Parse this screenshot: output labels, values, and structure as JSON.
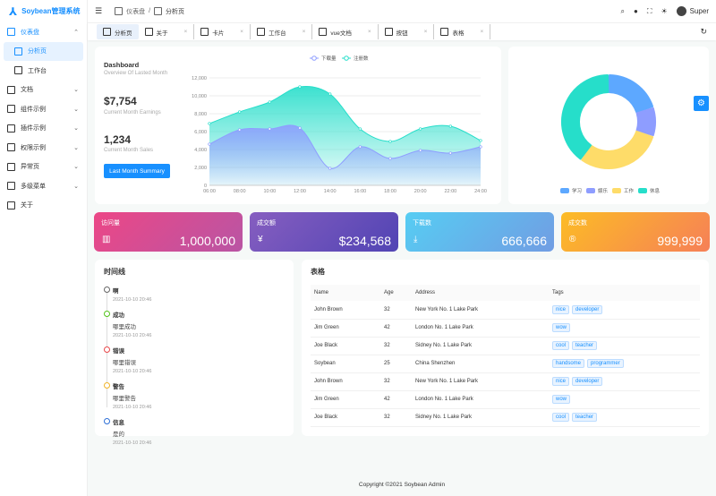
{
  "app": {
    "title": "Soybean管理系统"
  },
  "sidebar": {
    "items": [
      {
        "label": "仪表盘",
        "icon": "dashboard-icon",
        "open": true
      },
      {
        "label": "分析页",
        "icon": "analysis-icon",
        "active": true,
        "sub": true
      },
      {
        "label": "工作台",
        "icon": "monitor-icon",
        "sub": true
      },
      {
        "label": "文档",
        "icon": "document-icon"
      },
      {
        "label": "组件示例",
        "icon": "component-icon"
      },
      {
        "label": "插件示例",
        "icon": "plugin-icon"
      },
      {
        "label": "权限示例",
        "icon": "shield-icon"
      },
      {
        "label": "异常页",
        "icon": "exception-icon"
      },
      {
        "label": "多级菜单",
        "icon": "menu-icon"
      },
      {
        "label": "关于",
        "icon": "about-icon"
      }
    ]
  },
  "header": {
    "breadcrumb": [
      "仪表盘",
      "分析页"
    ],
    "user": "Super"
  },
  "tabs": [
    {
      "label": "分析页"
    },
    {
      "label": "关于"
    },
    {
      "label": "卡片"
    },
    {
      "label": "工作台"
    },
    {
      "label": "vue文档"
    },
    {
      "label": "按钮"
    },
    {
      "label": "表格"
    }
  ],
  "overview": {
    "title": "Dashboard",
    "subtitle": "Overview Of Lasted Month",
    "earnings": "$7,754",
    "earnings_label": "Current Month Earnings",
    "sales": "1,234",
    "sales_label": "Current Month Sales",
    "button": "Last Month Summary"
  },
  "stats": [
    {
      "title": "访问量",
      "value": "1,000,000",
      "icon": "chart-icon",
      "colors": [
        "#ec4786",
        "#b955a4"
      ]
    },
    {
      "title": "成交额",
      "value": "$234,568",
      "icon": "money-icon",
      "colors": [
        "#865ec0",
        "#5144b4"
      ]
    },
    {
      "title": "下载数",
      "value": "666,666",
      "icon": "download-icon",
      "colors": [
        "#56cdf3",
        "#719de3"
      ]
    },
    {
      "title": "成交数",
      "value": "999,999",
      "icon": "registered-icon",
      "colors": [
        "#fcbc25",
        "#f68057"
      ]
    }
  ],
  "chart_data": [
    {
      "type": "area",
      "x": [
        "06:00",
        "08:00",
        "10:00",
        "12:00",
        "14:00",
        "16:00",
        "18:00",
        "20:00",
        "22:00",
        "24:00"
      ],
      "ylim": [
        0,
        12000
      ],
      "yticks": [
        "0",
        "2,000",
        "4,000",
        "6,000",
        "8,000",
        "10,000",
        "12,000"
      ],
      "grid": true,
      "legend": "top",
      "series": [
        {
          "name": "下载量",
          "color": "#8e9dff",
          "values": [
            4600,
            6200,
            6300,
            6400,
            1900,
            4300,
            3000,
            3900,
            3600,
            4300
          ]
        },
        {
          "name": "注册数",
          "color": "#26deca",
          "values": [
            6900,
            8200,
            9300,
            11000,
            10200,
            6300,
            4900,
            6300,
            6600,
            5000
          ]
        }
      ]
    },
    {
      "type": "pie",
      "legend": "bottom",
      "series": [
        {
          "name": "学习",
          "value": 20,
          "color": "#5da8ff"
        },
        {
          "name": "娱乐",
          "value": 10,
          "color": "#8e9dff"
        },
        {
          "name": "工作",
          "value": 30,
          "color": "#fedc69"
        },
        {
          "name": "休息",
          "value": 40,
          "color": "#26deca"
        }
      ]
    }
  ],
  "timeline": {
    "title": "时间线",
    "items": [
      {
        "title": "啊",
        "content": "",
        "time": "2021-10-10 20:46",
        "color": "#666"
      },
      {
        "title": "成功",
        "content": "哪里成功",
        "time": "2021-10-10 20:46",
        "color": "#52c41a"
      },
      {
        "title": "错误",
        "content": "哪里错误",
        "time": "2021-10-10 20:46",
        "color": "#e84749"
      },
      {
        "title": "警告",
        "content": "哪里警告",
        "time": "2021-10-10 20:46",
        "color": "#f0b429"
      },
      {
        "title": "信息",
        "content": "是的",
        "time": "2021-10-10 20:46",
        "color": "#2d6fd6"
      }
    ]
  },
  "table": {
    "title": "表格",
    "columns": [
      "Name",
      "Age",
      "Address",
      "Tags"
    ],
    "rows": [
      [
        "John Brown",
        "32",
        "New York No. 1 Lake Park",
        [
          "nice",
          "developer"
        ]
      ],
      [
        "Jim Green",
        "42",
        "London No. 1 Lake Park",
        [
          "wow"
        ]
      ],
      [
        "Joe Black",
        "32",
        "Sidney No. 1 Lake Park",
        [
          "cool",
          "teacher"
        ]
      ],
      [
        "Soybean",
        "25",
        "China Shenzhen",
        [
          "handsome",
          "programmer"
        ]
      ],
      [
        "John Brown",
        "32",
        "New York No. 1 Lake Park",
        [
          "nice",
          "developer"
        ]
      ],
      [
        "Jim Green",
        "42",
        "London No. 1 Lake Park",
        [
          "wow"
        ]
      ],
      [
        "Joe Black",
        "32",
        "Sidney No. 1 Lake Park",
        [
          "cool",
          "teacher"
        ]
      ]
    ]
  },
  "footer": "Copyright ©2021 Soybean Admin"
}
